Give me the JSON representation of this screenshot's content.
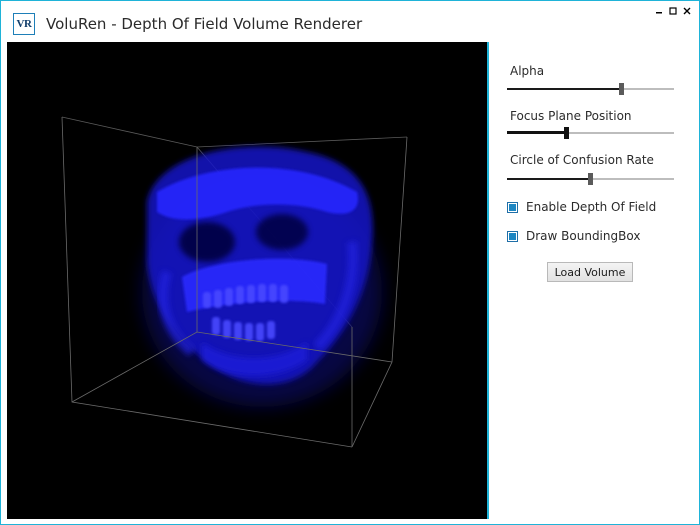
{
  "window": {
    "title": "VoluRen - Depth Of Field Volume Renderer",
    "icon_text": "VR",
    "icon_name": "app-logo-icon",
    "accent_color": "#1fb3d8"
  },
  "controls": {
    "minimize_icon": "minimize-icon",
    "maximize_icon": "maximize-icon",
    "close_icon": "close-icon"
  },
  "viewport": {
    "background": "#000000",
    "volume_color": "#1a1aff",
    "shows_bounding_box": true
  },
  "panel": {
    "sliders": [
      {
        "label": "Alpha",
        "value_fraction": 0.69
      },
      {
        "label": "Focus Plane Position",
        "value_fraction": 0.35
      },
      {
        "label": "Circle of Confusion Rate",
        "value_fraction": 0.5
      }
    ],
    "checkboxes": [
      {
        "label": "Enable Depth Of Field",
        "checked": true
      },
      {
        "label": "Draw BoundingBox",
        "checked": true
      }
    ],
    "load_button": "Load Volume"
  }
}
